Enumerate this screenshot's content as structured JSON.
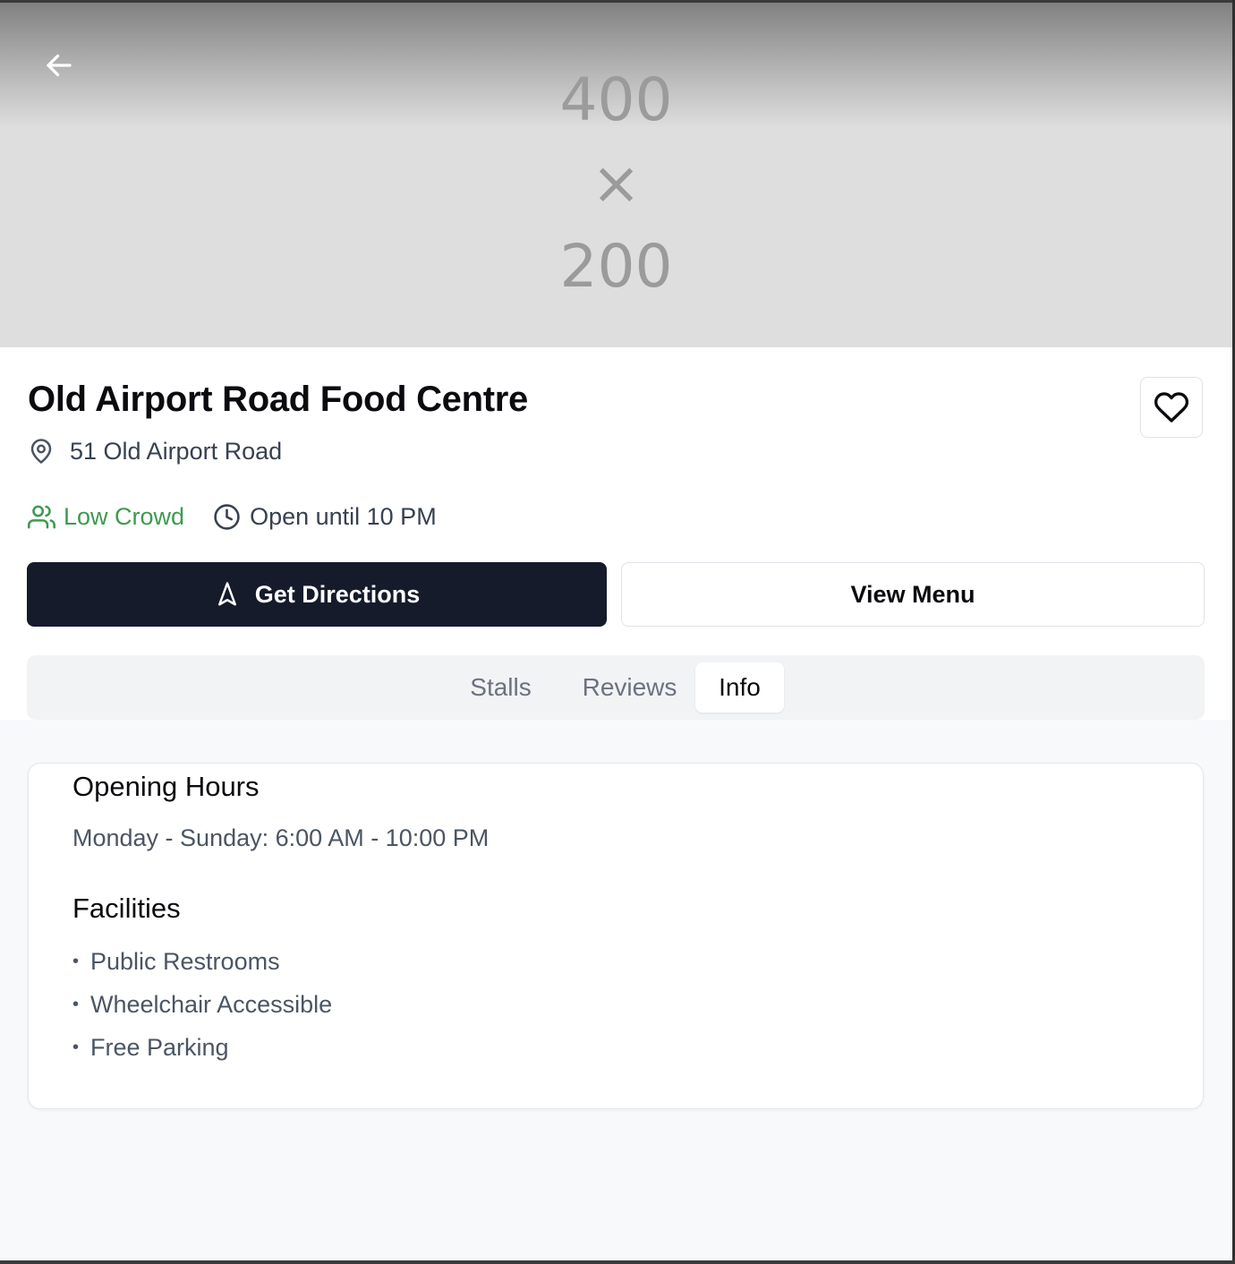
{
  "hero": {
    "placeholder_top": "400",
    "placeholder_mid": "×",
    "placeholder_bottom": "200"
  },
  "header": {
    "title": "Old Airport Road Food Centre",
    "address": "51 Old Airport Road"
  },
  "status": {
    "crowd_label": "Low Crowd",
    "hours_label": "Open until 10 PM"
  },
  "actions": {
    "directions_label": "Get Directions",
    "menu_label": "View Menu"
  },
  "tabs": [
    {
      "label": "Stalls",
      "active": false
    },
    {
      "label": "Reviews",
      "active": false
    },
    {
      "label": "Info",
      "active": true
    }
  ],
  "info": {
    "hours_title": "Opening Hours",
    "hours_text": "Monday - Sunday: 6:00 AM - 10:00 PM",
    "facilities_title": "Facilities",
    "facilities": [
      {
        "bullet": "•",
        "label": "Public Restrooms"
      },
      {
        "bullet": "•",
        "label": "Wheelchair Accessible"
      },
      {
        "bullet": "•",
        "label": "Free Parking"
      }
    ]
  },
  "colors": {
    "accent_dark": "#151b2b",
    "crowd_green": "#3e9a4f",
    "muted_text": "#4b5563"
  },
  "icons": {
    "back": "arrow-left-icon",
    "favorite": "heart-icon",
    "location": "map-pin-icon",
    "crowd": "users-icon",
    "hours": "clock-icon",
    "directions": "navigation-icon"
  }
}
